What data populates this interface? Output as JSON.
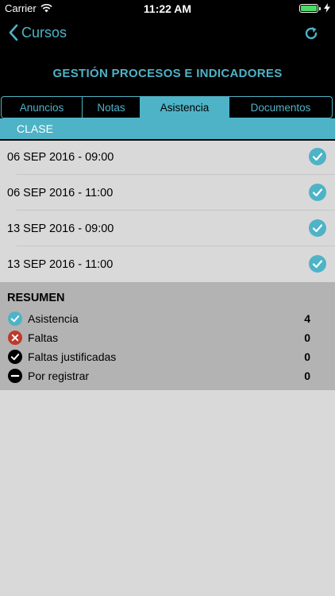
{
  "status_bar": {
    "carrier": "Carrier",
    "time": "11:22 AM"
  },
  "nav": {
    "back_label": "Cursos"
  },
  "page_title": "GESTIÓN PROCESOS E INDICADORES",
  "tabs": [
    {
      "label": "Anuncios",
      "active": false
    },
    {
      "label": "Notas",
      "active": false
    },
    {
      "label": "Asistencia",
      "active": true
    },
    {
      "label": "Documentos",
      "active": false
    }
  ],
  "section_header": "CLASE",
  "sessions": [
    {
      "label": "06 SEP 2016 - 09:00",
      "status": "check-circle-icon"
    },
    {
      "label": "06 SEP 2016 - 11:00",
      "status": "check-circle-icon"
    },
    {
      "label": "13 SEP 2016 - 09:00",
      "status": "check-circle-icon"
    },
    {
      "label": "13 SEP 2016 - 11:00",
      "status": "check-circle-icon"
    }
  ],
  "summary": {
    "title": "RESUMEN",
    "items": [
      {
        "label": "Asistencia",
        "count": "4",
        "icon": "check-circle-icon"
      },
      {
        "label": "Faltas",
        "count": "0",
        "icon": "x-circle-icon"
      },
      {
        "label": "Faltas justificadas",
        "count": "0",
        "icon": "check-circle-dark-icon"
      },
      {
        "label": "Por registrar",
        "count": "0",
        "icon": "minus-circle-icon"
      }
    ]
  },
  "colors": {
    "accent": "#4eb3c6",
    "absent": "#c0392b",
    "dark": "#000000"
  }
}
